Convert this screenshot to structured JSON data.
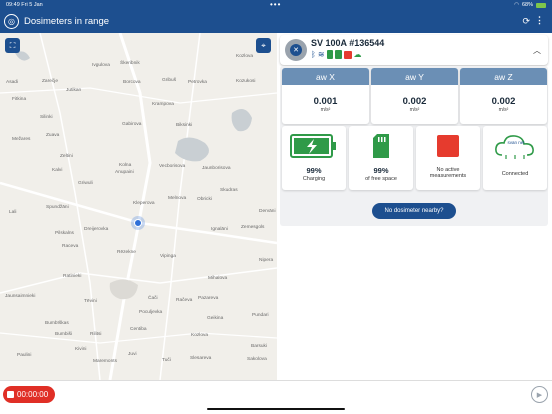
{
  "status_bar": {
    "time": "09:49",
    "date": "Fri 5 Jan",
    "battery": "68%"
  },
  "app_bar": {
    "title": "Dosimeters in range",
    "refresh_icon": "refresh-icon",
    "menu_icon": "more-vert-icon"
  },
  "map": {
    "towns": [
      "Ivgulova",
      "Škeribnik",
      "Kozlova",
      "Asadi",
      "Zarečje",
      "Jutikan",
      "Borcova",
      "Gribuš",
      "Petrovka",
      "Kozukosi",
      "Fitkina",
      "Krampova",
      "Silinki",
      "Gabirova",
      "Biksinki",
      "Zuava",
      "Mežares",
      "Zeltini",
      "Kalvi",
      "Kolna",
      "Vecborisova",
      "Jaunborisova",
      "Anupaini",
      "Griwuli",
      "Skudras",
      "Spundžāni",
      "Kleperova",
      "Melnova",
      "Obricki",
      "Lali",
      "Pilskalns",
      "Dreijerovka",
      "Ignalāni",
      "Zemesgols",
      "Raceva",
      "Rēzekne",
      "Vipinga",
      "Nipera",
      "Ratinieki",
      "Mihalova",
      "Jaunsaimnieki",
      "Tēvini",
      "Čači",
      "Račeva",
      "Pazareva",
      "Bumbīškas",
      "Poculjevka",
      "Geikina",
      "Pundari",
      "Bumbiši",
      "Rilitsi",
      "Centiba",
      "Kozlova",
      "Barsuki",
      "Paulini",
      "Kivini",
      "Juvi",
      "Maremonts",
      "Tuči",
      "Slesareva",
      "Sakolova",
      "Dervāni"
    ]
  },
  "device": {
    "name": "SV 100A #136544",
    "axes": [
      {
        "label": "aw X",
        "value": "0.001",
        "unit": "m/s²"
      },
      {
        "label": "aw Y",
        "value": "0.002",
        "unit": "m/s²"
      },
      {
        "label": "aw Z",
        "value": "0.002",
        "unit": "m/s²"
      }
    ],
    "stats": [
      {
        "value": "99%",
        "label": "Charging",
        "icon": "battery-charging-icon"
      },
      {
        "value": "99%",
        "label": "of free space",
        "icon": "sd-card-icon"
      },
      {
        "value": "",
        "label": "No active measurements",
        "icon": "stop-square-icon"
      },
      {
        "value": "",
        "label": "Connected",
        "icon": "svan-net-cloud-icon"
      }
    ],
    "cloud_text": "svan net"
  },
  "nearby_button": "No dosimeter nearby?",
  "recorder": {
    "time": "00:00:00"
  },
  "colors": {
    "primary": "#1d4f8f",
    "axis_header": "#6b8fb5",
    "record": "#e02f26",
    "ok_green": "#2f9a48"
  }
}
